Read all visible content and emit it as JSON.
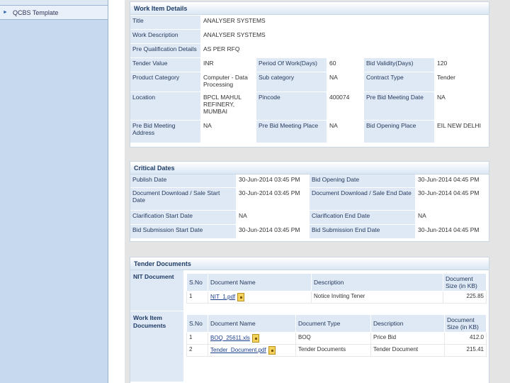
{
  "sidebar": {
    "items": [
      {
        "label": "QCBS Template"
      }
    ]
  },
  "work_item": {
    "title": "Work Item Details",
    "rows": {
      "title_label": "Title",
      "title_value": "ANALYSER SYSTEMS",
      "desc_label": "Work Description",
      "desc_value": "ANALYSER SYSTEMS",
      "preq_label": "Pre Qualification Details",
      "preq_value": "AS PER RFQ"
    },
    "grid": {
      "tender_value_label": "Tender Value",
      "tender_value": "INR",
      "period_label": "Period Of Work(Days)",
      "period_value": "60",
      "validity_label": "Bid Validity(Days)",
      "validity_value": "120",
      "product_label": "Product Category",
      "product_value": "Computer - Data Processing",
      "subcat_label": "Sub category",
      "subcat_value": "NA",
      "contract_label": "Contract Type",
      "contract_value": "Tender",
      "location_label": "Location",
      "location_value": "BPCL MAHUL REFINERY, MUMBAI",
      "pincode_label": "Pincode",
      "pincode_value": "400074",
      "prebid_date_label": "Pre Bid Meeting Date",
      "prebid_date_value": "NA",
      "prebid_addr_label": "Pre Bid Meeting Address",
      "prebid_addr_value": "NA",
      "prebid_place_label": "Pre Bid Meeting Place",
      "prebid_place_value": "NA",
      "bid_open_place_label": "Bid Opening Place",
      "bid_open_place_value": "EIL NEW DELHI"
    }
  },
  "critical_dates": {
    "title": "Critical Dates",
    "publish_label": "Publish Date",
    "publish_value": "30-Jun-2014 03:45 PM",
    "bid_open_label": "Bid Opening Date",
    "bid_open_value": "30-Jun-2014 04:45 PM",
    "doc_start_label": "Document Download / Sale Start Date",
    "doc_start_value": "30-Jun-2014 03:45 PM",
    "doc_end_label": "Document Download / Sale End Date",
    "doc_end_value": "30-Jun-2014 04:45 PM",
    "clar_start_label": "Clarification Start Date",
    "clar_start_value": "NA",
    "clar_end_label": "Clarification End Date",
    "clar_end_value": "NA",
    "bid_sub_start_label": "Bid Submission Start Date",
    "bid_sub_start_value": "30-Jun-2014 03:45 PM",
    "bid_sub_end_label": "Bid Submission End Date",
    "bid_sub_end_value": "30-Jun-2014 04:45 PM"
  },
  "tender_docs": {
    "title": "Tender Documents",
    "nit": {
      "label": "NIT Document",
      "headers": {
        "sno": "S.No",
        "name": "Document Name",
        "desc": "Description",
        "size": "Document Size (in KB)"
      },
      "rows": [
        {
          "sno": "1",
          "name": "NIT_1.pdf",
          "desc": "Notice Inviting Tener",
          "size": "225.85"
        }
      ]
    },
    "work": {
      "label": "Work Item Documents",
      "headers": {
        "sno": "S.No",
        "name": "Document Name",
        "type": "Document Type",
        "desc": "Description",
        "size": "Document Size (in KB)"
      },
      "rows": [
        {
          "sno": "1",
          "name": "BOQ_25611.xls",
          "type": "BOQ",
          "desc": "Price Bid",
          "size": "412.0"
        },
        {
          "sno": "2",
          "name": "Tender_Document.pdf",
          "type": "Tender Documents",
          "desc": "Tender Document",
          "size": "215.41"
        }
      ]
    }
  }
}
